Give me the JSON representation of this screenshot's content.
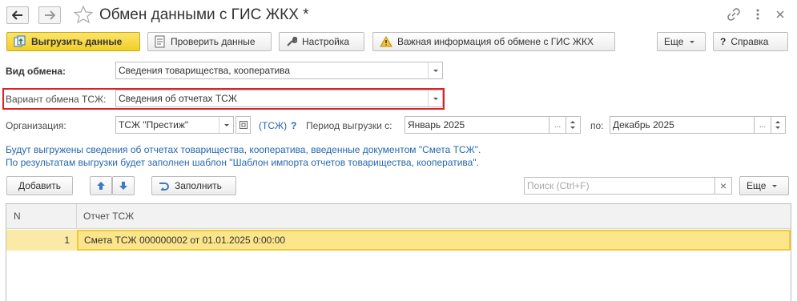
{
  "window": {
    "title": "Обмен данными с ГИС ЖКХ *"
  },
  "toolbar": {
    "upload_label": "Выгрузить данные",
    "check_label": "Проверить данные",
    "settings_label": "Настройка",
    "important_label": "Важная информация об обмене с ГИС ЖКХ",
    "more_label": "Еще",
    "help_label": "Справка"
  },
  "form": {
    "exchange_type_label": "Вид обмена:",
    "exchange_type_value": "Сведения товарищества, кооператива",
    "variant_label": "Вариант обмена ТСЖ:",
    "variant_value": "Сведения об отчетах ТСЖ",
    "org_label": "Организация:",
    "org_value": "ТСЖ \"Престиж\"",
    "org_kind": "(ТСЖ)",
    "org_help": "?",
    "period_label": "Период выгрузки с:",
    "period_from": "Январь 2025",
    "period_to_label": "по:",
    "period_to": "Декабрь 2025",
    "dots": "..."
  },
  "info": {
    "line1": "Будут выгружены сведения об отчетах товарищества, кооператива, введенные документом \"Смета ТСЖ\".",
    "line2": "По результатам выгрузки будет заполнен шаблон \"Шаблон импорта отчетов товарищества, кооператива\"."
  },
  "table_toolbar": {
    "add_label": "Добавить",
    "fill_label": "Заполнить",
    "search_placeholder": "Поиск (Ctrl+F)",
    "clear": "×",
    "more_label": "Еще"
  },
  "table": {
    "columns": [
      "N",
      "Отчет ТСЖ"
    ],
    "rows": [
      {
        "n": "1",
        "report": "Смета ТСЖ 000000002 от 01.01.2025 0:00:00"
      }
    ]
  },
  "colors": {
    "accent": "#f2cf26",
    "highlight": "#e31e24",
    "link": "#2668b0",
    "selected_row": "#fce58a"
  },
  "icons": [
    "back-arrow-icon",
    "forward-arrow-icon",
    "star-icon",
    "link-icon",
    "more-vertical-icon",
    "close-icon",
    "upload-icon",
    "check-document-icon",
    "wrench-icon",
    "warning-icon",
    "help-icon",
    "arrow-up-icon",
    "arrow-down-icon",
    "fill-arrow-icon",
    "open-form-icon"
  ]
}
